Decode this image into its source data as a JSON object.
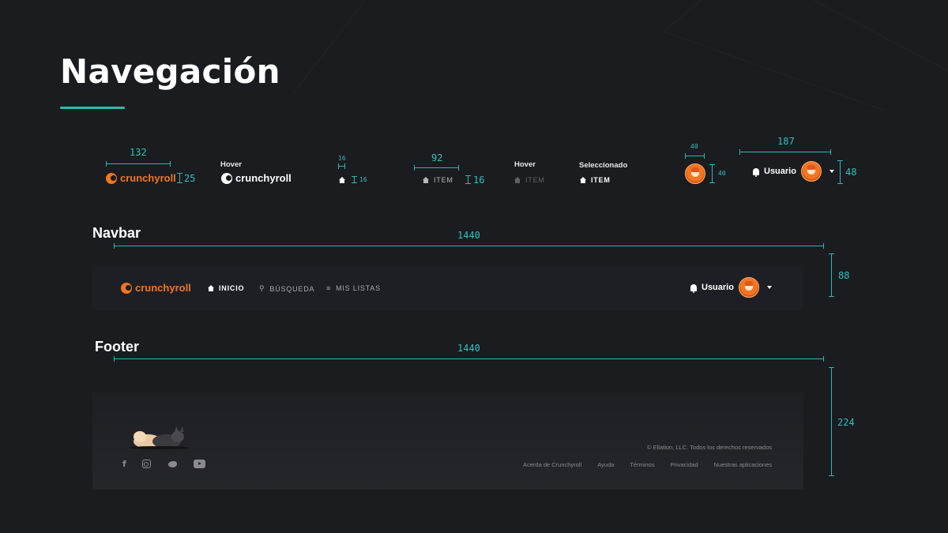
{
  "page": {
    "title": "Navegación"
  },
  "components": {
    "logo_text": "crunchyroll",
    "logo_width": "132",
    "logo_height": "25",
    "hover_label": "Hover",
    "icon_w": "16",
    "icon_h": "16",
    "item_width": "92",
    "item_height": "16",
    "item_label": "ITEM",
    "item_hover_label": "Hover",
    "item_selected_label": "Seleccionado",
    "avatar_w": "40",
    "avatar_h": "40",
    "user_width": "187",
    "user_height": "48",
    "user_label": "Usuario"
  },
  "navbar": {
    "section_label": "Navbar",
    "width": "1440",
    "height": "88",
    "logo_text": "crunchyroll",
    "items": [
      {
        "label": "INICIO",
        "icon": "home-icon",
        "selected": true
      },
      {
        "label": "BÚSQUEDA",
        "icon": "search-icon",
        "selected": false
      },
      {
        "label": "MIS LISTAS",
        "icon": "list-icon",
        "selected": false
      }
    ],
    "user_label": "Usuario"
  },
  "footer": {
    "section_label": "Footer",
    "width": "1440",
    "height": "224",
    "copyright": "© Ellation, LLC. Todos los derechos reservados",
    "links": [
      "Acerda de Crunchyroll",
      "Ayuda",
      "Términos",
      "Privacidad",
      "Nuestras aplicaciones"
    ],
    "social": [
      "facebook-icon",
      "instagram-icon",
      "twitter-icon",
      "youtube-icon"
    ]
  },
  "colors": {
    "background": "#1b1c20",
    "accent": "#2bbbad",
    "brand": "#f47521",
    "surface": "#1e1f24"
  }
}
